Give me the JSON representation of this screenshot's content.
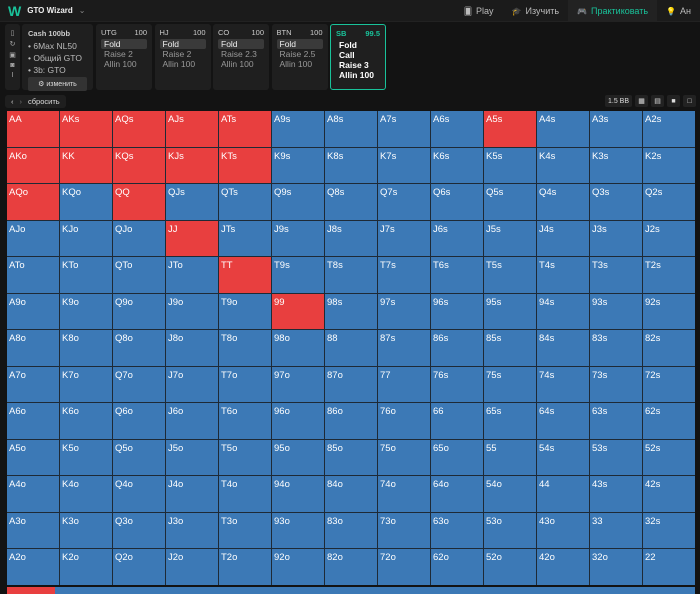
{
  "app": {
    "logo": "W",
    "title": "GTO Wizard"
  },
  "nav": [
    {
      "label": "Play",
      "icon": "cards-icon"
    },
    {
      "label": "Изучить",
      "icon": "graduation-cap-icon"
    },
    {
      "label": "Практиковать",
      "icon": "gamepad-icon",
      "active": true
    },
    {
      "label": "Ан",
      "icon": "lightbulb-icon"
    }
  ],
  "info": {
    "title": "Cash 100bb",
    "lines": [
      "• 6Max NL50",
      "• Общий GTO",
      "• 3b: GTO"
    ],
    "edit": "⚙ изменить"
  },
  "positions": [
    {
      "name": "UTG",
      "stack": "100",
      "options": [
        "Fold",
        "Raise 2",
        "Allin 100"
      ]
    },
    {
      "name": "HJ",
      "stack": "100",
      "options": [
        "Fold",
        "Raise 2",
        "Allin 100"
      ]
    },
    {
      "name": "CO",
      "stack": "100",
      "options": [
        "Fold",
        "Raise 2.3",
        "Allin 100"
      ]
    },
    {
      "name": "BTN",
      "stack": "100",
      "options": [
        "Fold",
        "Raise 2.5",
        "Allin 100"
      ]
    },
    {
      "name": "SB",
      "stack": "99.5",
      "options": [
        "Fold",
        "Call",
        "Raise 3",
        "Allin 100"
      ]
    }
  ],
  "reset": "сбросить",
  "pot": "1.5 BB",
  "colors": {
    "raise": "#e83f3f",
    "fold": "#3c79b6",
    "accent": "#19c29a"
  },
  "red_hands": [
    "AA",
    "AKs",
    "AQs",
    "AJs",
    "ATs",
    "A5s",
    "AKo",
    "KK",
    "KQs",
    "KJs",
    "KTs",
    "AQo",
    "QQ",
    "JJ",
    "TT",
    "99"
  ],
  "range_fraction": 0.07
}
